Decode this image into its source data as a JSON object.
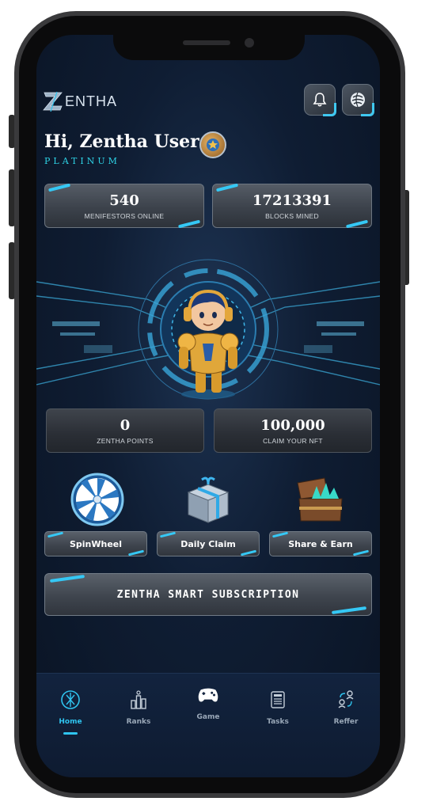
{
  "header": {
    "logo_text": "ENTHA",
    "notification_icon": "bell-icon",
    "wallet_icon": "globe-wallet-icon"
  },
  "user": {
    "greeting": "Hi, Zentha User",
    "tier": "PLATINUM",
    "badge_icon": "star-shield-icon"
  },
  "stats": [
    {
      "value": "540",
      "label": "MENIFESTORS ONLINE"
    },
    {
      "value": "17213391",
      "label": "BLOCKS MINED"
    }
  ],
  "points": [
    {
      "value": "0",
      "label": "ZENTHA POINTS"
    },
    {
      "value": "100,000",
      "label": "CLAIM YOUR NFT"
    }
  ],
  "rewards": [
    {
      "label": "SpinWheel",
      "icon": "spin-wheel-icon"
    },
    {
      "label": "Daily Claim",
      "icon": "gift-box-icon"
    },
    {
      "label": "Share & Earn",
      "icon": "treasure-chest-icon"
    }
  ],
  "subscription": {
    "label": "ZENTHA SMART SUBSCRIPTION"
  },
  "nav": {
    "active": "Home",
    "items": [
      {
        "label": "Home",
        "icon": "home-icon"
      },
      {
        "label": "Ranks",
        "icon": "bar-chart-icon"
      },
      {
        "label": "Game",
        "icon": "gamepad-icon"
      },
      {
        "label": "Tasks",
        "icon": "tasks-icon"
      },
      {
        "label": "Reffer",
        "icon": "referral-icon"
      }
    ]
  },
  "colors": {
    "accent": "#2fc4ef",
    "tier": "#2ed3e6",
    "background": "#0f1d33",
    "stone": "#3f454e"
  }
}
